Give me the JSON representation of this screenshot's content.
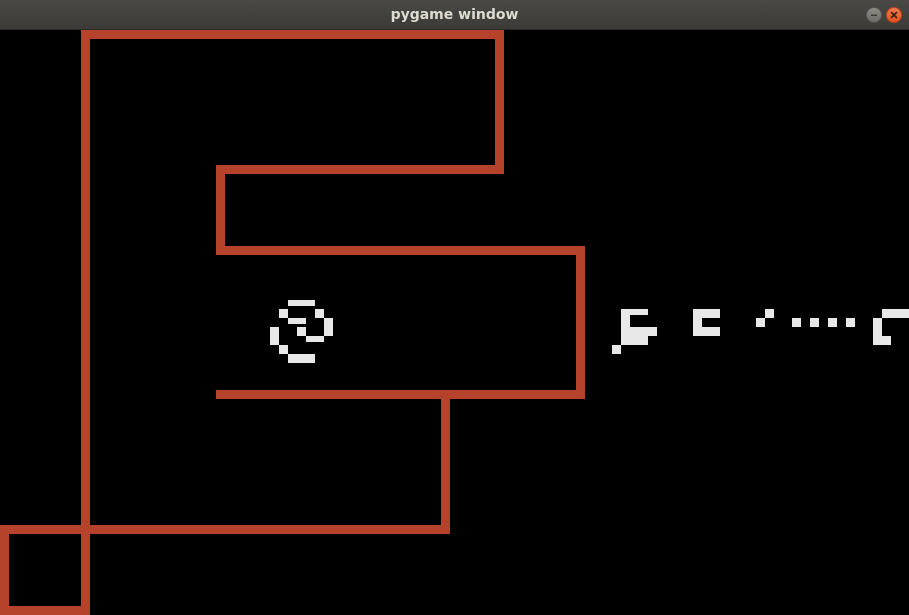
{
  "window": {
    "title": "pygame window",
    "controls": [
      {
        "name": "minimize",
        "icon": "minimize-icon"
      },
      {
        "name": "close",
        "icon": "close-icon"
      }
    ]
  },
  "colors": {
    "background": "#000000",
    "wall": "#b5432c",
    "sprite": "#e8e8e8",
    "close_button": "#e95420"
  }
}
